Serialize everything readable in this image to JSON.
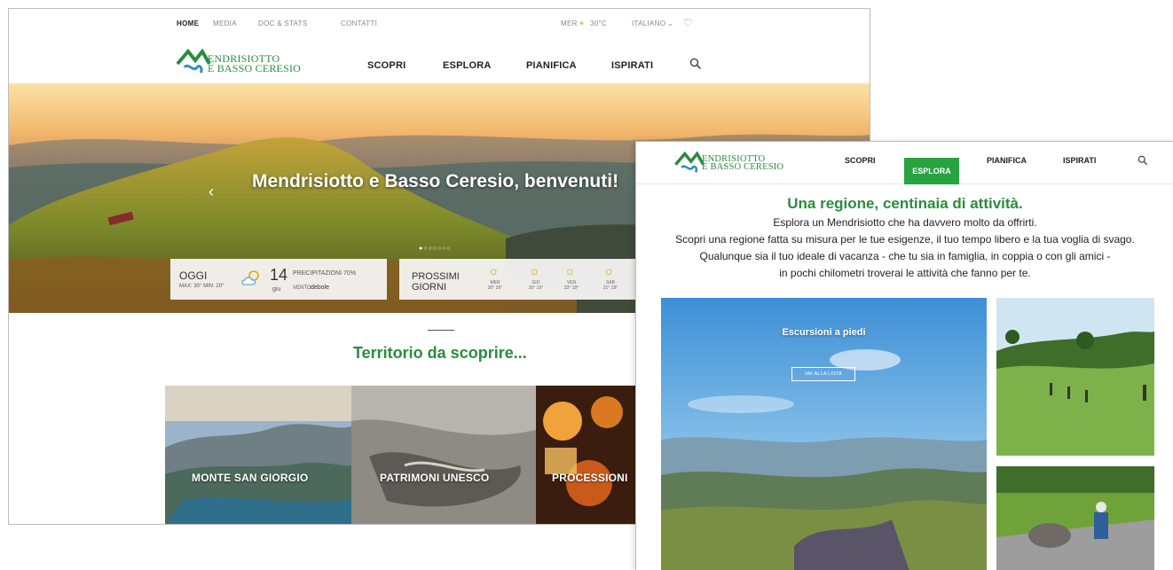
{
  "back": {
    "topnav": {
      "items": [
        "HOME",
        "MEDIA",
        "DOC & STATS",
        "CONTATTI"
      ],
      "weather": "MER",
      "temp": "30°C",
      "language": "ITALIANO"
    },
    "logo": {
      "line1": "ENDRISIOTTO",
      "line2": "E BASSO CERESIO",
      "initial": "M"
    },
    "mainnav": [
      "SCOPRI",
      "ESPLORA",
      "PIANIFICA",
      "ISPIRATI"
    ],
    "hero": {
      "title": "Mendrisiotto e Basso Ceresio, benvenuti!",
      "today": {
        "label": "OGGI",
        "minmax": "MAX: 30° MIN: 20°",
        "day": "14",
        "month": "giu",
        "precip": "PRECIPITAZIONI 70%",
        "wind_label": "VENTO",
        "wind_value": "debole"
      },
      "next": {
        "label_line1": "PROSSIMI",
        "label_line2": "GIORNI",
        "days": [
          {
            "name": "MER",
            "temps": "30° 20°"
          },
          {
            "name": "GIO",
            "temps": "30° 19°"
          },
          {
            "name": "VEN",
            "temps": "33° 18°"
          },
          {
            "name": "SAB",
            "temps": "31° 18°"
          }
        ]
      }
    },
    "section_title": "Territorio da scoprire...",
    "tiles": [
      "MONTE SAN GIORGIO",
      "PATRIMONI UNESCO",
      "PROCESSIONI"
    ]
  },
  "front": {
    "logo": {
      "line1": "ENDRISIOTTO",
      "line2": "E BASSO CERESIO",
      "initial": "M"
    },
    "nav": [
      "SCOPRI",
      "ESPLORA",
      "PIANIFICA",
      "ISPIRATI"
    ],
    "active_nav": "ESPLORA",
    "title": "Una regione, centinaia di attività.",
    "intro": [
      "Esplora un Mendrisiotto che ha davvero molto da offrirti.",
      "Scopri una regione fatta su misura per le tue esigenze, il tuo tempo libero e la tua voglia di svago.",
      "Qualunque sia il tuo ideale di vacanza - che tu sia in famiglia, in coppia o con gli amici -",
      "in pochi chilometri troverai le attività che fanno per te."
    ],
    "card": {
      "title": "Escursioni a piedi",
      "button": "VAI ALLA LISTA"
    }
  },
  "colors": {
    "brand_green": "#2a8c3f",
    "active_green": "#27a341",
    "logo_blue": "#2f8fc4"
  },
  "icons": [
    "heart-icon",
    "search-icon",
    "chevron-left-icon",
    "sun-cloud-icon",
    "sun-icon",
    "logo-icon"
  ]
}
